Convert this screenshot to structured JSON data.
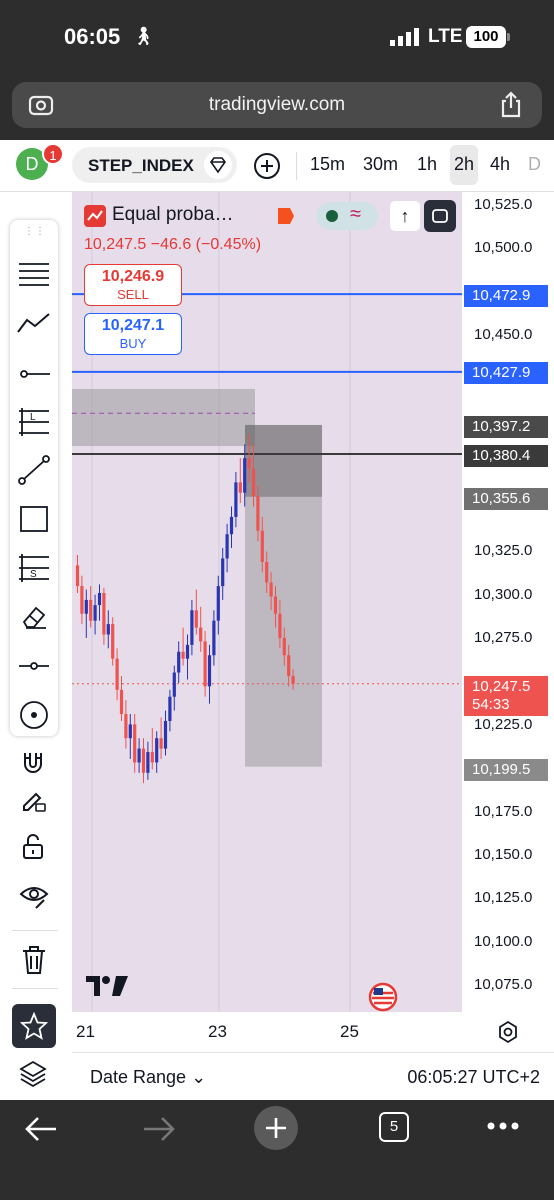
{
  "status_bar": {
    "time": "06:05",
    "network": "LTE",
    "battery": "100"
  },
  "browser": {
    "url": "tradingview.com"
  },
  "toolbar": {
    "avatar_letter": "D",
    "notification_count": "1",
    "symbol": "STEP_INDEX",
    "timeframes": [
      "15m",
      "30m",
      "1h",
      "2h",
      "4h",
      "D"
    ],
    "active_timeframe": "2h"
  },
  "legend": {
    "indicator_title": "Equal proba…",
    "change": "10,247.5  −46.6 (−0.45%)",
    "sell_price": "10,246.9",
    "sell_label": "SELL",
    "buy_price": "10,247.1",
    "buy_label": "BUY"
  },
  "price_axis": {
    "labels": [
      "10,525.0",
      "10,500.0",
      "10,450.0",
      "10,325.0",
      "10,300.0",
      "10,275.0",
      "10,225.0",
      "10,175.0",
      "10,150.0",
      "10,125.0",
      "10,100.0",
      "10,075.0"
    ],
    "tags": [
      {
        "value": "10,472.9",
        "color": "#2962ff"
      },
      {
        "value": "10,427.9",
        "color": "#2962ff"
      },
      {
        "value": "10,397.2",
        "color": "#4a4a4a"
      },
      {
        "value": "10,380.4",
        "color": "#3a3a3a"
      },
      {
        "value": "10,355.6",
        "color": "#707070"
      },
      {
        "value": "10,199.5",
        "color": "#8a8a8a"
      }
    ],
    "last_price": "10,247.5",
    "countdown": "54:33"
  },
  "x_axis": {
    "labels": [
      "21",
      "23",
      "25"
    ]
  },
  "bottom": {
    "date_range": "Date Range",
    "clock": "06:05:27 UTC+2"
  },
  "colors": {
    "up": "#2a36b1",
    "down": "#ef5350",
    "chart_bg": "#e6dcea"
  },
  "candles": [
    [
      10316,
      10322,
      10300,
      10304
    ],
    [
      10304,
      10310,
      10282,
      10288
    ],
    [
      10288,
      10302,
      10274,
      10296
    ],
    [
      10296,
      10304,
      10280,
      10284
    ],
    [
      10284,
      10299,
      10276,
      10293
    ],
    [
      10293,
      10305,
      10284,
      10300
    ],
    [
      10300,
      10303,
      10270,
      10276
    ],
    [
      10276,
      10290,
      10268,
      10282
    ],
    [
      10282,
      10286,
      10258,
      10262
    ],
    [
      10262,
      10268,
      10238,
      10244
    ],
    [
      10244,
      10252,
      10226,
      10230
    ],
    [
      10230,
      10238,
      10210,
      10216
    ],
    [
      10216,
      10230,
      10204,
      10224
    ],
    [
      10224,
      10230,
      10196,
      10202
    ],
    [
      10202,
      10216,
      10196,
      10210
    ],
    [
      10210,
      10216,
      10190,
      10196
    ],
    [
      10196,
      10214,
      10192,
      10208
    ],
    [
      10208,
      10222,
      10198,
      10202
    ],
    [
      10202,
      10220,
      10196,
      10216
    ],
    [
      10216,
      10228,
      10204,
      10210
    ],
    [
      10210,
      10232,
      10206,
      10226
    ],
    [
      10226,
      10244,
      10220,
      10240
    ],
    [
      10240,
      10258,
      10232,
      10254
    ],
    [
      10254,
      10272,
      10248,
      10266
    ],
    [
      10266,
      10280,
      10258,
      10262
    ],
    [
      10262,
      10276,
      10250,
      10270
    ],
    [
      10270,
      10296,
      10264,
      10290
    ],
    [
      10290,
      10302,
      10276,
      10280
    ],
    [
      10280,
      10292,
      10266,
      10272
    ],
    [
      10272,
      10278,
      10240,
      10246
    ],
    [
      10246,
      10270,
      10236,
      10264
    ],
    [
      10264,
      10290,
      10258,
      10284
    ],
    [
      10284,
      10310,
      10276,
      10304
    ],
    [
      10304,
      10326,
      10296,
      10320
    ],
    [
      10320,
      10340,
      10312,
      10334
    ],
    [
      10334,
      10350,
      10326,
      10344
    ],
    [
      10344,
      10370,
      10338,
      10364
    ],
    [
      10364,
      10378,
      10352,
      10358
    ],
    [
      10358,
      10386,
      10350,
      10378
    ],
    [
      10378,
      10392,
      10364,
      10372
    ],
    [
      10372,
      10386,
      10350,
      10356
    ],
    [
      10356,
      10362,
      10330,
      10336
    ],
    [
      10336,
      10344,
      10312,
      10318
    ],
    [
      10318,
      10324,
      10300,
      10306
    ],
    [
      10306,
      10312,
      10290,
      10298
    ],
    [
      10298,
      10304,
      10280,
      10288
    ],
    [
      10288,
      10296,
      10268,
      10274
    ],
    [
      10274,
      10280,
      10258,
      10264
    ],
    [
      10264,
      10270,
      10246,
      10252
    ],
    [
      10252,
      10256,
      10244,
      10247.5
    ]
  ]
}
